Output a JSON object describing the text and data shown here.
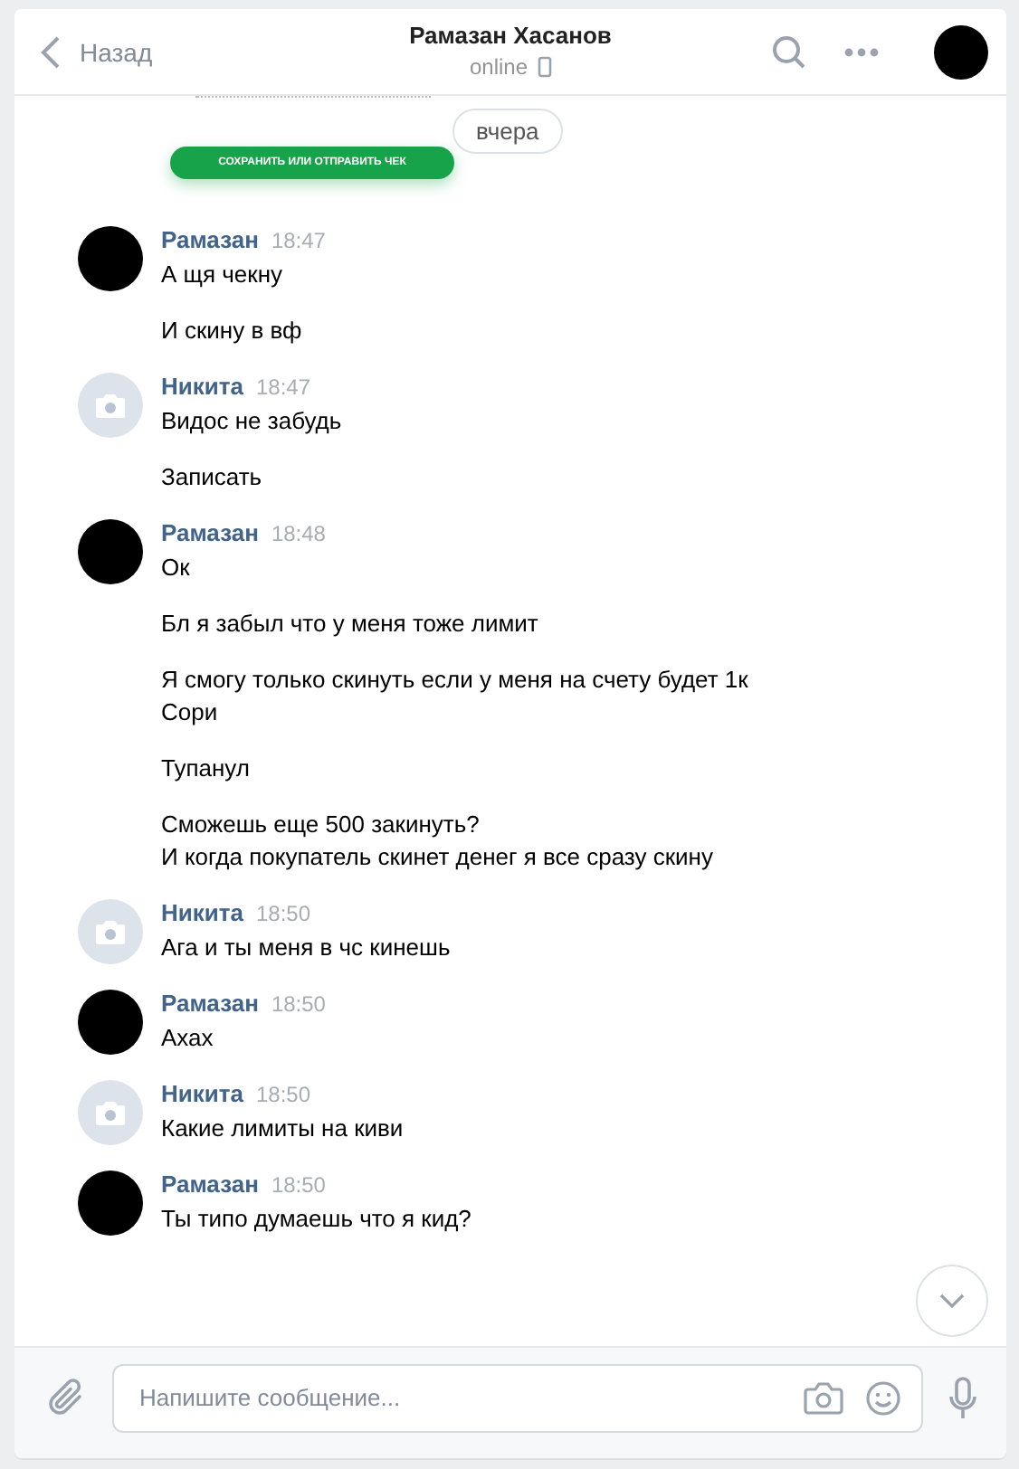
{
  "header": {
    "back": "Назад",
    "title": "Рамазан Хасанов",
    "status": "online",
    "avatar": {
      "kind": "photo"
    }
  },
  "top": {
    "date": "вчера",
    "button": "СОХРАНИТЬ ИЛИ ОТПРАВИТЬ ЧЕК"
  },
  "groups": [
    {
      "name": "Рамазан",
      "time": "18:47",
      "kind": "photo",
      "messages": [
        [
          "А щя чекну"
        ],
        [
          "И скину в вф"
        ]
      ]
    },
    {
      "name": "Никита",
      "time": "18:47",
      "kind": "placeholder",
      "messages": [
        [
          "Видос не забудь"
        ],
        [
          "Записать"
        ]
      ]
    },
    {
      "name": "Рамазан",
      "time": "18:48",
      "kind": "photo",
      "messages": [
        [
          "Ок"
        ],
        [
          "Бл я забыл что у меня тоже лимит"
        ],
        [
          "Я смогу только скинуть если у меня на счету будет 1к",
          "Сори"
        ],
        [
          "Тупанул"
        ],
        [
          "Сможешь еще 500 закинуть?",
          "И когда покупатель скинет денег я все сразу скину"
        ]
      ]
    },
    {
      "name": "Никита",
      "time": "18:50",
      "kind": "placeholder",
      "messages": [
        [
          "Ага и ты меня в чс кинешь"
        ]
      ]
    },
    {
      "name": "Рамазан",
      "time": "18:50",
      "kind": "photo",
      "messages": [
        [
          "Ахах"
        ]
      ]
    },
    {
      "name": "Никита",
      "time": "18:50",
      "kind": "placeholder",
      "messages": [
        [
          "Какие лимиты на киви"
        ]
      ]
    },
    {
      "name": "Рамазан",
      "time": "18:50",
      "kind": "photo",
      "messages": [
        [
          "Ты типо думаешь что я кид?"
        ]
      ]
    }
  ],
  "composer": {
    "placeholder": "Напишите сообщение..."
  }
}
